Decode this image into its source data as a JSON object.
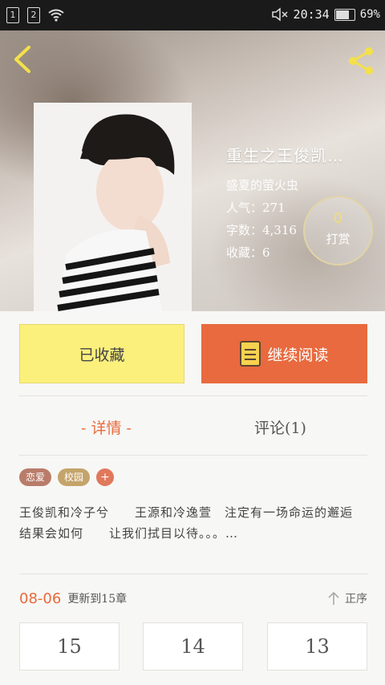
{
  "status_bar": {
    "sim1": "1",
    "sim2": "2",
    "time": "20:34",
    "battery": "69%",
    "battery_level": 0.69
  },
  "header": {
    "back_icon": "chevron-left-icon",
    "share_icon": "share-icon"
  },
  "book": {
    "title": "重生之王俊凯…",
    "author": "盛夏的萤火虫",
    "popularity": "人气：271",
    "word_count": "字数：4,316",
    "favorites": "收藏：6",
    "tip_count": "0",
    "tip_label": "打赏"
  },
  "actions": {
    "favorited_label": "已收藏",
    "continue_label": "继续阅读"
  },
  "tabs": {
    "details": "- 详情 -",
    "comments": "评论(1)"
  },
  "tags": [
    "恋爱",
    "校园"
  ],
  "tag_add": "+",
  "description": "王俊凯和冷子兮　　王源和冷逸萱　注定有一场命运的邂逅　　结果会如何　　让我们拭目以待。。。…",
  "update": {
    "date": "08-06",
    "text": "更新到15章",
    "sort_label": "正序"
  },
  "chapters": [
    "15",
    "14",
    "13"
  ],
  "colors": {
    "accent": "#e86a3e",
    "favorite_bg": "#fbf07c"
  }
}
